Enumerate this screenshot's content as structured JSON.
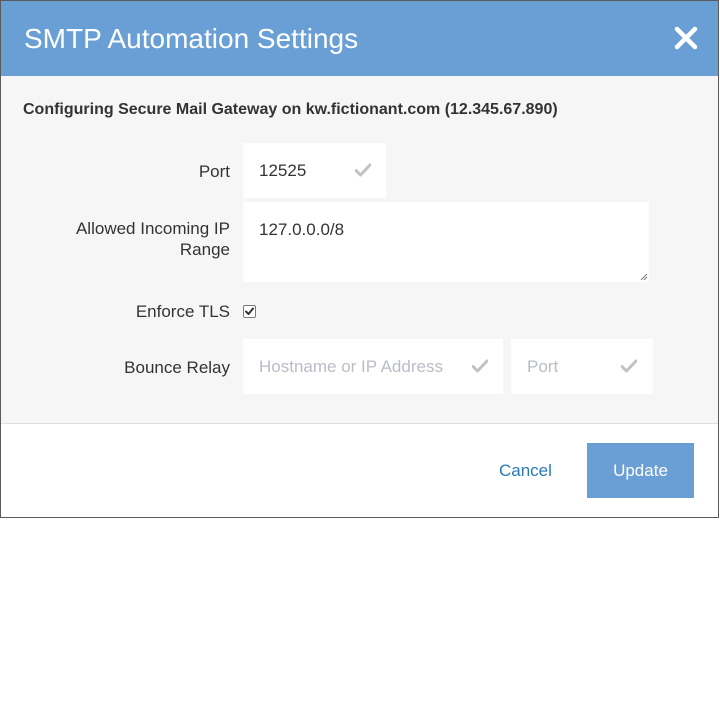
{
  "dialog": {
    "title": "SMTP Automation Settings",
    "config_line": "Configuring Secure Mail Gateway on kw.fictionant.com (12.345.67.890)"
  },
  "fields": {
    "port": {
      "label": "Port",
      "value": "12525"
    },
    "ip_range": {
      "label": "Allowed Incoming IP Range",
      "value": "127.0.0.0/8"
    },
    "enforce_tls": {
      "label": "Enforce TLS",
      "checked": true
    },
    "bounce_relay": {
      "label": "Bounce Relay",
      "host_placeholder": "Hostname or IP Address",
      "port_placeholder": "Port"
    }
  },
  "footer": {
    "cancel_label": "Cancel",
    "update_label": "Update"
  },
  "colors": {
    "header": "#6a9fd6",
    "link": "#2a7ab8",
    "body_bg": "#f6f6f6"
  },
  "icons": [
    "close-icon",
    "checkmark-icon",
    "resize-handle-icon"
  ]
}
